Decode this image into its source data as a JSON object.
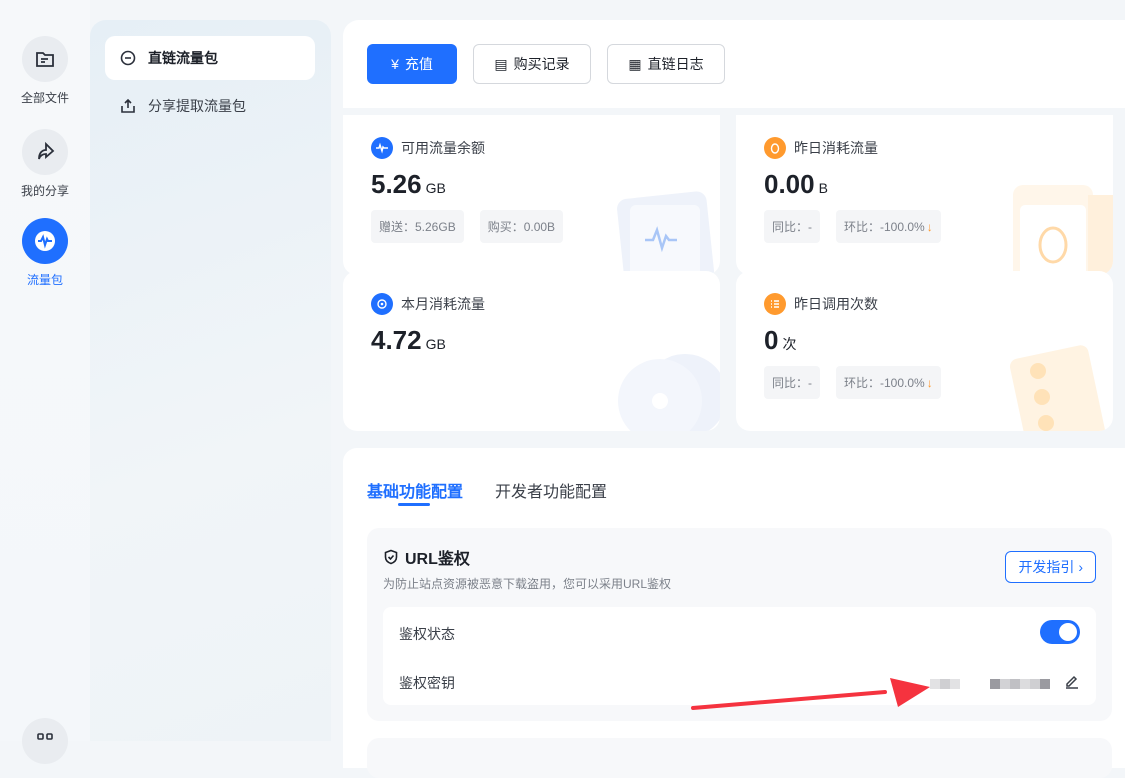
{
  "rail": [
    {
      "label": "全部文件",
      "icon": "folder-icon"
    },
    {
      "label": "我的分享",
      "icon": "share-icon"
    },
    {
      "label": "流量包",
      "icon": "traffic-icon",
      "active": true
    }
  ],
  "subnav": [
    {
      "label": "直链流量包",
      "active": true
    },
    {
      "label": "分享提取流量包"
    }
  ],
  "toolbar": {
    "recharge": "充值",
    "purchase_record": "购买记录",
    "direct_log": "直链日志"
  },
  "cards": {
    "available": {
      "title": "可用流量余额",
      "value": "5.26",
      "unit": "GB",
      "gift": "赠送：5.26GB",
      "bought": "购买：0.00B"
    },
    "yesterday": {
      "title": "昨日消耗流量",
      "value": "0.00",
      "unit": "B",
      "yoy": "同比：-",
      "mom": "环比：-100.0%"
    },
    "month": {
      "title": "本月消耗流量",
      "value": "4.72",
      "unit": "GB"
    },
    "calls": {
      "title": "昨日调用次数",
      "value": "0",
      "unit": "次",
      "yoy": "同比：-",
      "mom": "环比：-100.0%"
    }
  },
  "tabs": [
    "基础功能配置",
    "开发者功能配置"
  ],
  "url_auth": {
    "title": "URL鉴权",
    "desc": "为防止站点资源被恶意下载盗用，您可以采用URL鉴权",
    "guide": "开发指引",
    "status_label": "鉴权状态",
    "status_on": true,
    "key_label": "鉴权密钥"
  },
  "colors": {
    "primary": "#1f6fff",
    "orange": "#ff9a2e",
    "arrow": "#f5333f"
  }
}
